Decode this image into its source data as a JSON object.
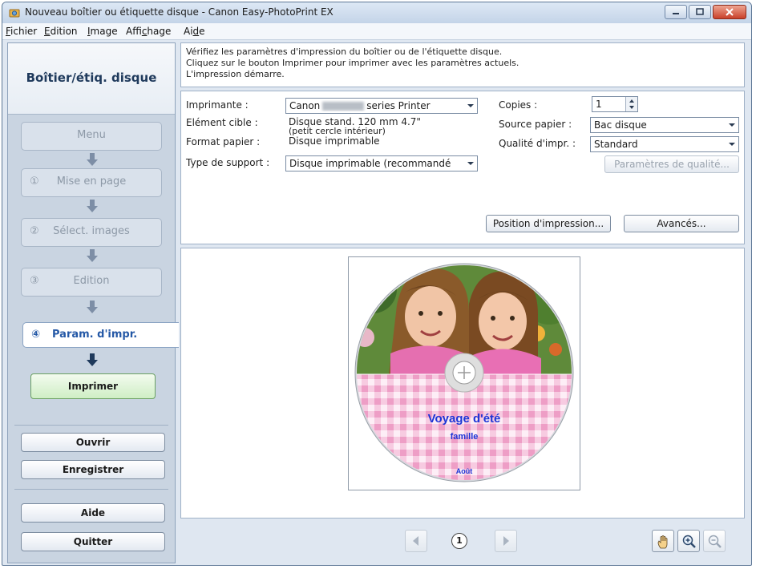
{
  "window": {
    "title": "Nouveau boîtier ou étiquette disque - Canon Easy-PhotoPrint EX"
  },
  "menu": {
    "items": [
      {
        "key": "F",
        "rest": "ichier"
      },
      {
        "key": "E",
        "rest": "dition"
      },
      {
        "key": "I",
        "rest": "mage"
      },
      {
        "pre": "Affi",
        "key": "c",
        "rest": "hage"
      },
      {
        "pre": "Ai",
        "key": "d",
        "rest": "e"
      }
    ]
  },
  "sidebar": {
    "header": "Boîtier/étiq. disque",
    "steps": [
      {
        "num": "",
        "label": "Menu"
      },
      {
        "num": "①",
        "label": "Mise en page"
      },
      {
        "num": "②",
        "label": "Sélect. images"
      },
      {
        "num": "③",
        "label": "Edition"
      }
    ],
    "active_step": {
      "num": "④",
      "label": "Param. d'impr."
    },
    "print_label": "Imprimer",
    "buttons": [
      "Ouvrir",
      "Enregistrer",
      "Aide",
      "Quitter"
    ]
  },
  "info": {
    "lines": [
      "Vérifiez les paramètres d'impression du boîtier ou de l'étiquette disque.",
      "Cliquez sur le bouton Imprimer pour imprimer avec les paramètres actuels.",
      "L'impression démarre."
    ]
  },
  "settings": {
    "printer_label": "Imprimante :",
    "printer_value_a": "Canon",
    "printer_value_b": "series Printer",
    "target_label": "Elément cible :",
    "target_value_1": "Disque stand. 120 mm 4.7\"",
    "target_value_2": "(petit cercle intérieur)",
    "paper_size_label": "Format papier :",
    "paper_size_value": "Disque imprimable",
    "media_type_label": "Type de support :",
    "media_type_value": "Disque imprimable (recommandé",
    "copies_label": "Copies :",
    "copies_value": "1",
    "paper_source_label": "Source papier :",
    "paper_source_value": "Bac disque",
    "quality_label": "Qualité d'impr. :",
    "quality_value": "Standard",
    "quality_settings_button": "Paramètres de qualité...",
    "print_position_button": "Position d'impression...",
    "advanced_button": "Avancés..."
  },
  "preview": {
    "disc_title": "Voyage d'été",
    "disc_subtitle": "famille",
    "disc_month": "Août",
    "page_number": "1"
  },
  "colors": {
    "disc_text": "#1d35d6",
    "gingham_light": "#f8d3e7",
    "gingham_mid": "#f1a9cc"
  }
}
